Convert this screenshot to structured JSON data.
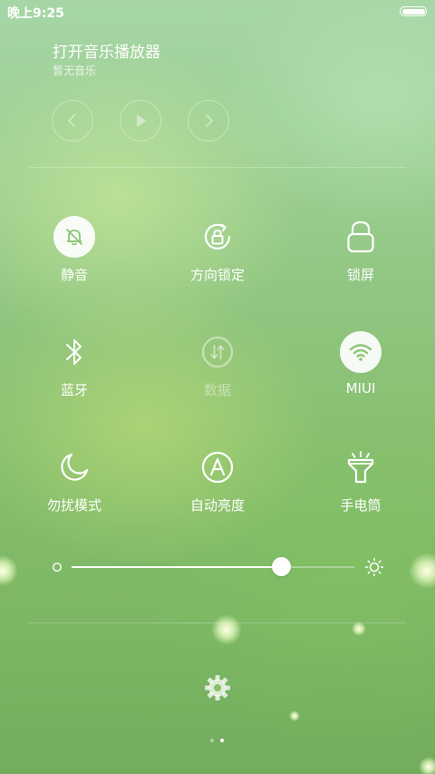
{
  "status_bar": {
    "time": "晚上9:25"
  },
  "music": {
    "title": "打开音乐播放器",
    "subtitle": "暂无音乐",
    "controls": [
      "previous-icon",
      "play-icon",
      "next-icon"
    ]
  },
  "toggles": [
    {
      "label": "静音",
      "icon": "bell-off-icon",
      "active": true
    },
    {
      "label": "方向锁定",
      "icon": "rotation-lock-icon",
      "active": false
    },
    {
      "label": "锁屏",
      "icon": "lock-icon",
      "active": false
    },
    {
      "label": "蓝牙",
      "icon": "bluetooth-icon",
      "active": false
    },
    {
      "label": "数据",
      "icon": "mobile-data-icon",
      "active": false,
      "disabled": true
    },
    {
      "label": "MIUI",
      "icon": "wifi-icon",
      "active": true
    },
    {
      "label": "勿扰模式",
      "icon": "moon-icon",
      "active": false
    },
    {
      "label": "自动亮度",
      "icon": "auto-brightness-icon",
      "active": false
    },
    {
      "label": "手电筒",
      "icon": "flashlight-icon",
      "active": false
    }
  ],
  "brightness": {
    "level": 0.74
  },
  "settings": {
    "icon": "gear-icon"
  },
  "pager": {
    "pages": 2,
    "current": 1
  },
  "colors": {
    "active_icon": "#8cc576",
    "background_top": "#a6d6a6",
    "background_bottom": "#72ad5d"
  }
}
